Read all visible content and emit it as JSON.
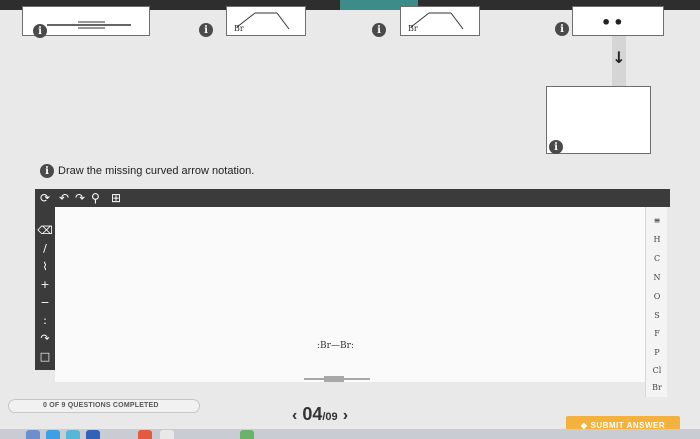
{
  "prompt": {
    "text": "Draw the missing curved arrow notation."
  },
  "top_boxes": [
    {
      "icon": "info-icon",
      "glyph": "i"
    },
    {
      "icon": "info-icon",
      "glyph": "i",
      "label": "Br"
    },
    {
      "icon": "info-icon",
      "glyph": "i",
      "label": "Br"
    },
    {
      "icon": "info-icon",
      "glyph": "i",
      "dots": "••"
    }
  ],
  "answer_box": {
    "icon": "info-icon",
    "glyph": "i"
  },
  "toolbar": {
    "icons": [
      "select-icon",
      "undo-icon",
      "redo-icon",
      "zoom-icon",
      "template-icon"
    ]
  },
  "tools": [
    "eraser-icon",
    "single-bond-icon",
    "chain-icon",
    "plus-charge-icon",
    "minus-charge-icon",
    "lone-pair-icon",
    "curved-arrow-icon",
    "ring-icon"
  ],
  "elements": [
    "H",
    "C",
    "N",
    "O",
    "S",
    "F",
    "P",
    "Cl",
    "Br"
  ],
  "canvas": {
    "molecule": {
      "left_atom": "Br",
      "right_atom": "Br"
    }
  },
  "footer": {
    "progress_text": "0 OF 9 QUESTIONS COMPLETED",
    "progress_fraction": 0,
    "pager_current": "04",
    "pager_total": "/09",
    "submit_label": "SUBMIT ANSWER"
  },
  "colors": {
    "accent": "#f3b13e",
    "toolbar": "#3b3b3b",
    "teal_tab": "#3c8c8a"
  }
}
